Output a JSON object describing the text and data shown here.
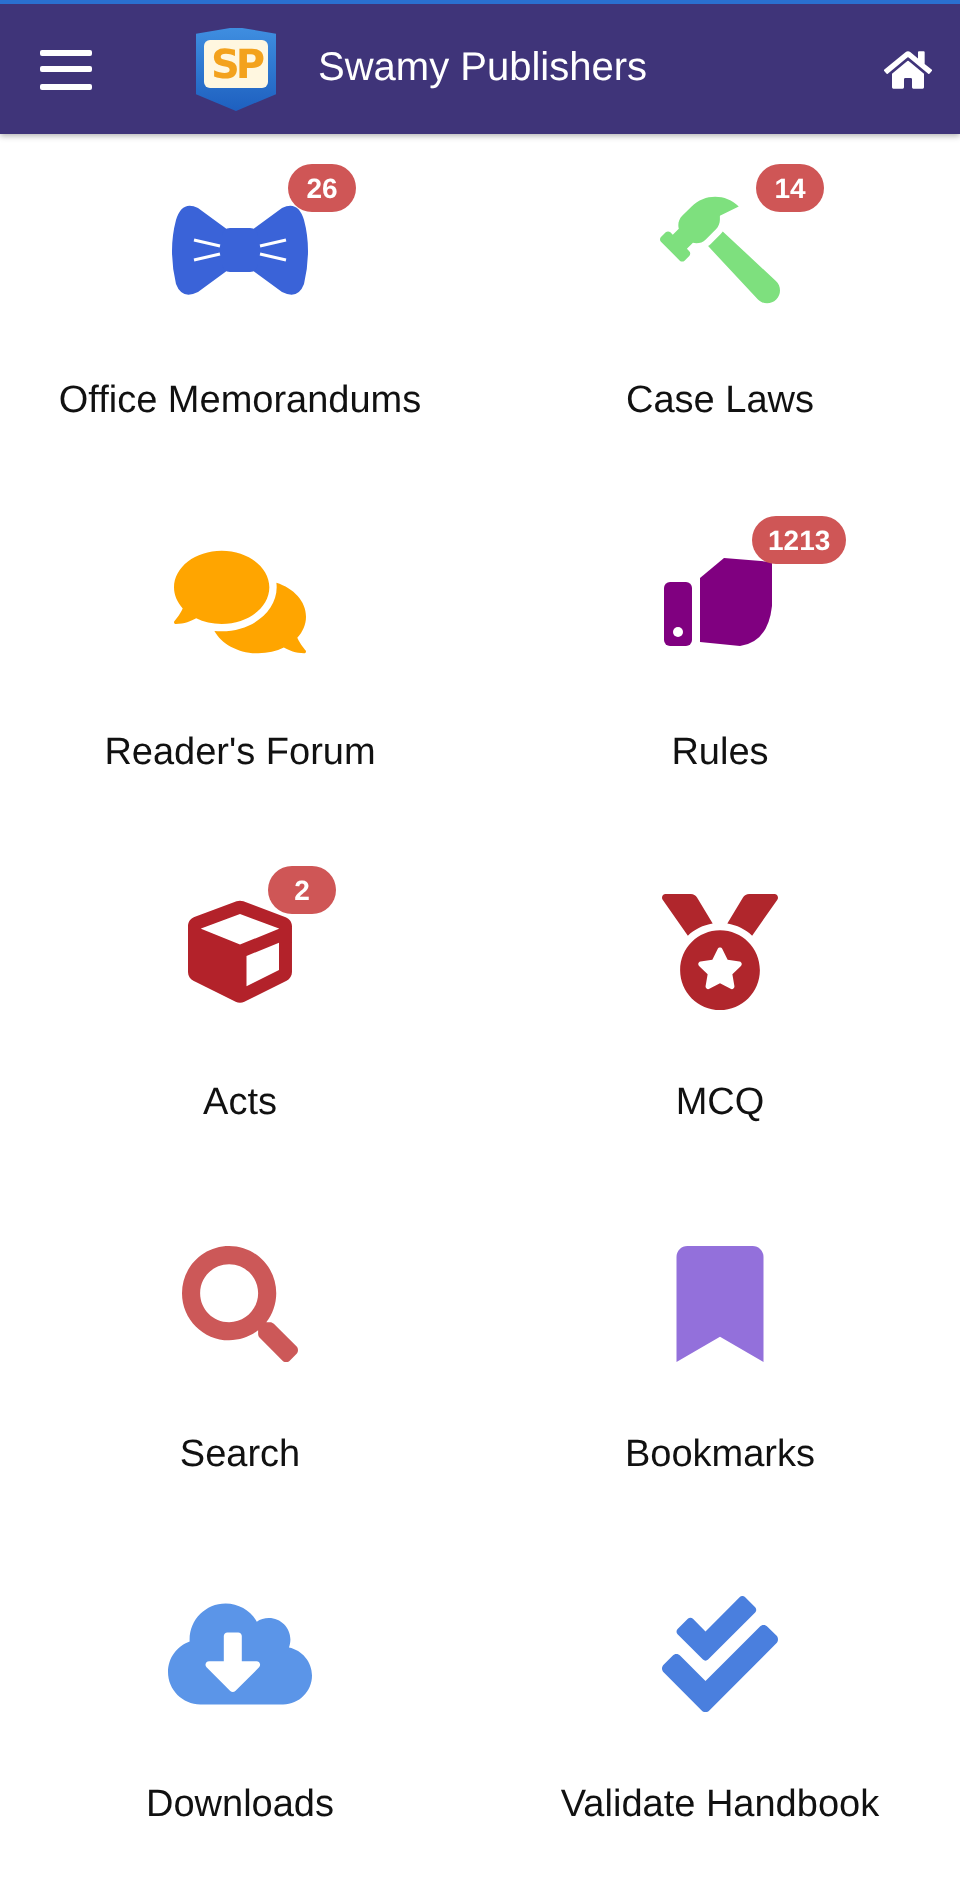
{
  "app_bar": {
    "logo_text": "SP",
    "title": "Swamy Publishers"
  },
  "tiles": [
    {
      "label": "Office Memorandums",
      "badge": "26"
    },
    {
      "label": "Case Laws",
      "badge": "14"
    },
    {
      "label": "Reader's Forum"
    },
    {
      "label": "Rules",
      "badge": "1213"
    },
    {
      "label": "Acts",
      "badge": "2"
    },
    {
      "label": "MCQ"
    },
    {
      "label": "Search"
    },
    {
      "label": "Bookmarks"
    },
    {
      "label": "Downloads"
    },
    {
      "label": "Validate Handbook"
    }
  ]
}
